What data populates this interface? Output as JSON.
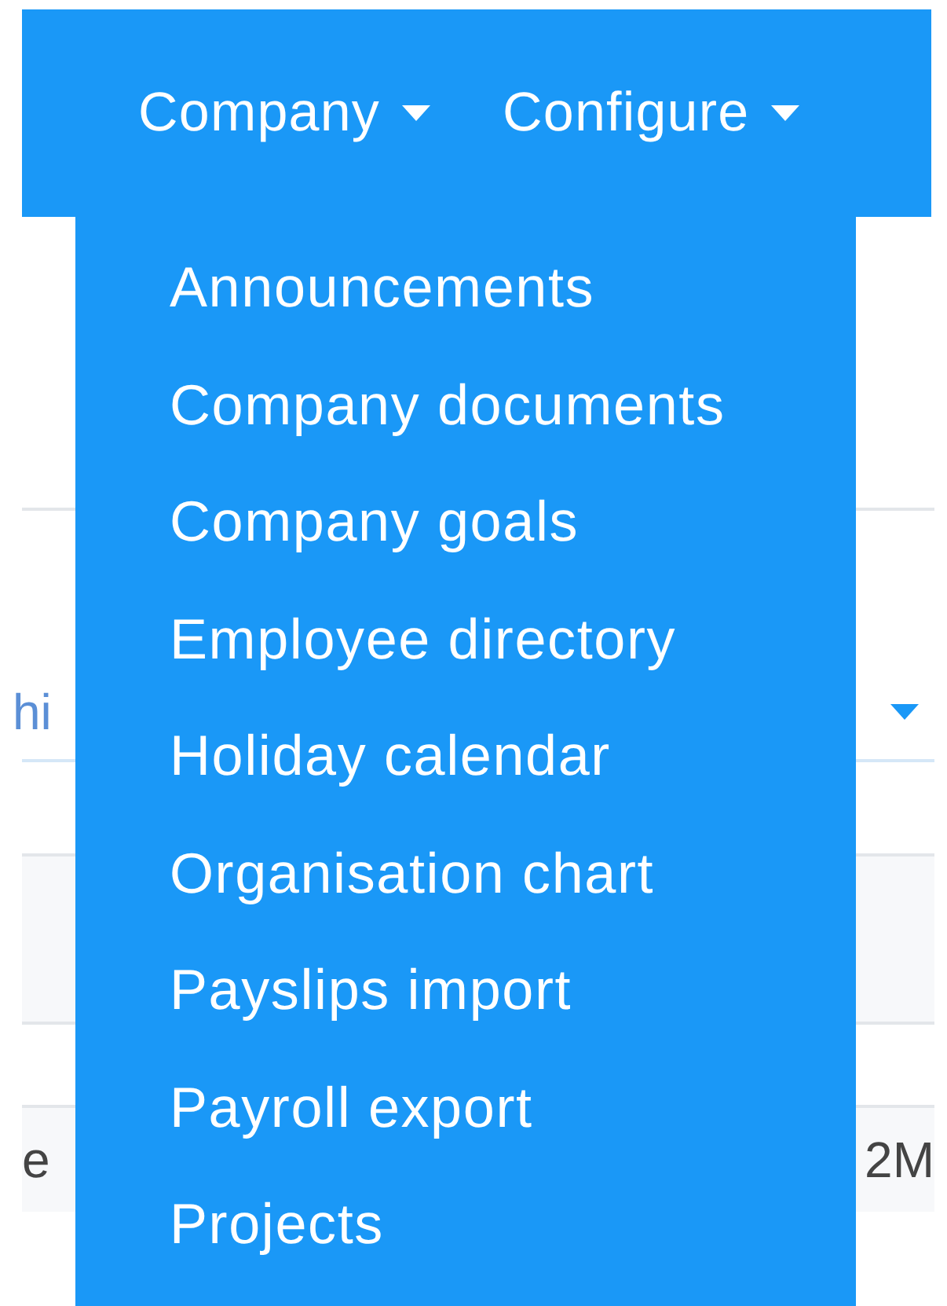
{
  "navbar": {
    "items": [
      "Company",
      "Configure"
    ]
  },
  "dropdown": {
    "items": [
      "Announcements",
      "Company documents",
      "Company goals",
      "Employee directory",
      "Holiday calendar",
      "Organisation chart",
      "Payslips import",
      "Payroll export",
      "Projects"
    ]
  },
  "background": {
    "select_value": "hi",
    "row_left_text": "e",
    "row_right_text": "2M"
  }
}
